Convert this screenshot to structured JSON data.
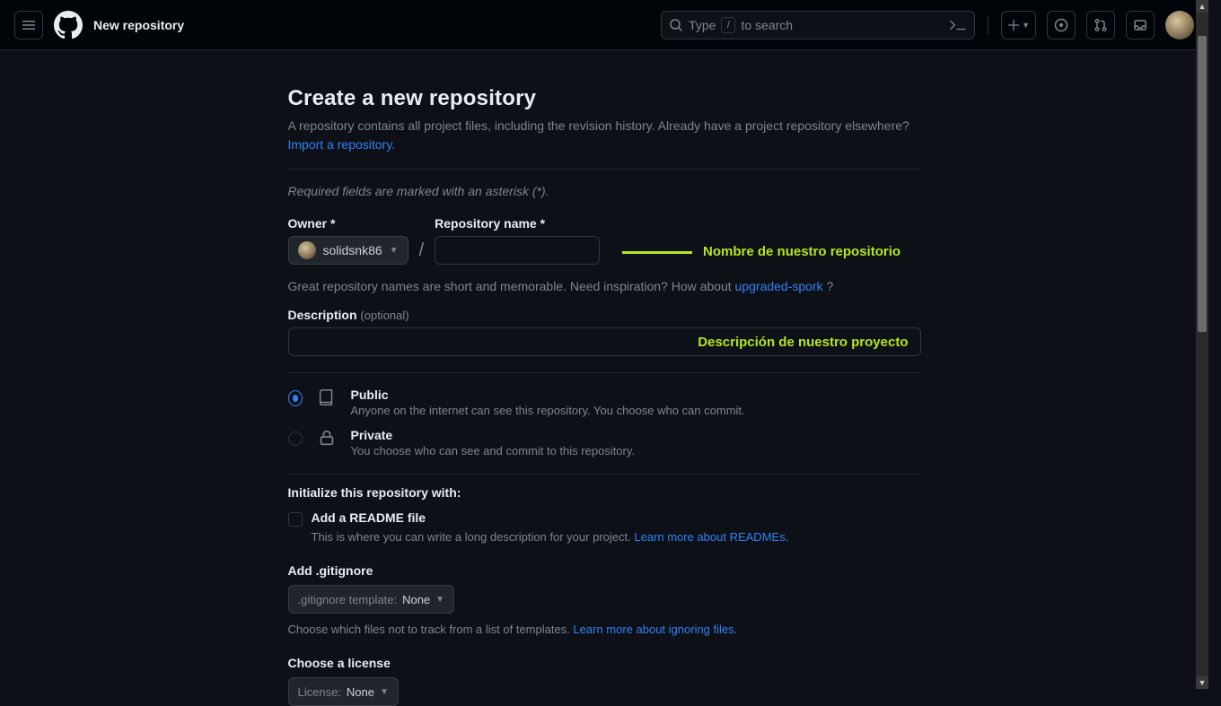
{
  "header": {
    "page_title": "New repository",
    "search_prefix": "Type",
    "search_slash": "/",
    "search_suffix": "to search"
  },
  "main": {
    "heading": "Create a new repository",
    "subtitle": "A repository contains all project files, including the revision history. Already have a project repository elsewhere?",
    "import_link": "Import a repository.",
    "required_note": "Required fields are marked with an asterisk (*).",
    "owner_label": "Owner *",
    "owner_value": "solidsnk86",
    "repo_name_label": "Repository name *",
    "repo_hint_pre": "Great repository names are short and memorable. Need inspiration? How about ",
    "repo_hint_suggestion": "upgraded-spork",
    "repo_hint_post": " ?",
    "desc_label": "Description",
    "desc_optional": "(optional)",
    "visibility": {
      "public_title": "Public",
      "public_desc": "Anyone on the internet can see this repository. You choose who can commit.",
      "private_title": "Private",
      "private_desc": "You choose who can see and commit to this repository."
    },
    "init_heading": "Initialize this repository with:",
    "readme_label": "Add a README file",
    "readme_note_pre": "This is where you can write a long description for your project. ",
    "readme_link": "Learn more about READMEs.",
    "gitignore_heading": "Add .gitignore",
    "gitignore_select_label": ".gitignore template:",
    "gitignore_value": "None",
    "gitignore_note_pre": "Choose which files not to track from a list of templates. ",
    "gitignore_link": "Learn more about ignoring files.",
    "license_heading": "Choose a license",
    "license_select_label": "License:",
    "license_value": "None"
  },
  "annotations": {
    "repo_name": "Nombre de nuestro repositorio",
    "description": "Descripción de nuestro proyecto"
  }
}
